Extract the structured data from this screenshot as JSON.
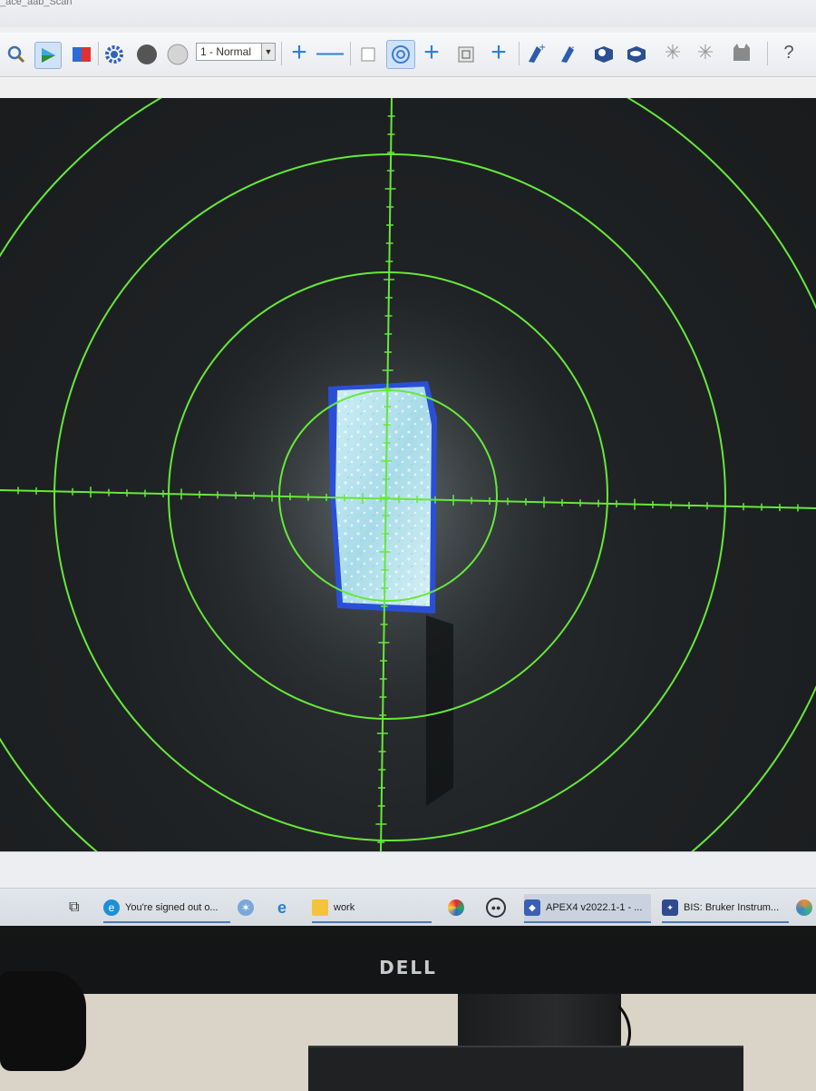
{
  "window": {
    "title_fragment": "_ace_aab_Scan"
  },
  "toolbar": {
    "mode_select": {
      "value": "1 - Normal"
    },
    "icons": [
      "zoom-icon",
      "play-icon",
      "color-mode-icon",
      "settings-gear-icon",
      "dark-circle-icon",
      "light-circle-icon",
      "add-icon",
      "line-icon",
      "square-icon",
      "target-icon",
      "add-icon",
      "frame-icon",
      "add-icon",
      "wand-add-icon",
      "wand-remove-icon",
      "cube-add-icon",
      "cube-remove-icon",
      "sparkle-add-icon",
      "sparkle-remove-icon",
      "cat-icon",
      "help-icon"
    ]
  },
  "viewer": {
    "overlay_color": "#66e83a",
    "crystal_color": "#bfe8f2",
    "background_color": "#1d2022"
  },
  "taskbar": {
    "items": [
      {
        "label": "You're signed out o...",
        "icon": "edge-icon"
      },
      {
        "label": "",
        "icon": "network-icon"
      },
      {
        "label": "",
        "icon": "ie-icon"
      },
      {
        "label": "work",
        "icon": "folder-icon"
      },
      {
        "label": "",
        "icon": "app-swirl-icon"
      },
      {
        "label": "",
        "icon": "app-dots-icon"
      },
      {
        "label": "APEX4 v2022.1-1 - ...",
        "icon": "apex-icon"
      },
      {
        "label": "BIS: Bruker Instrum...",
        "icon": "bis-icon"
      }
    ]
  },
  "monitor": {
    "brand": "DELL"
  }
}
